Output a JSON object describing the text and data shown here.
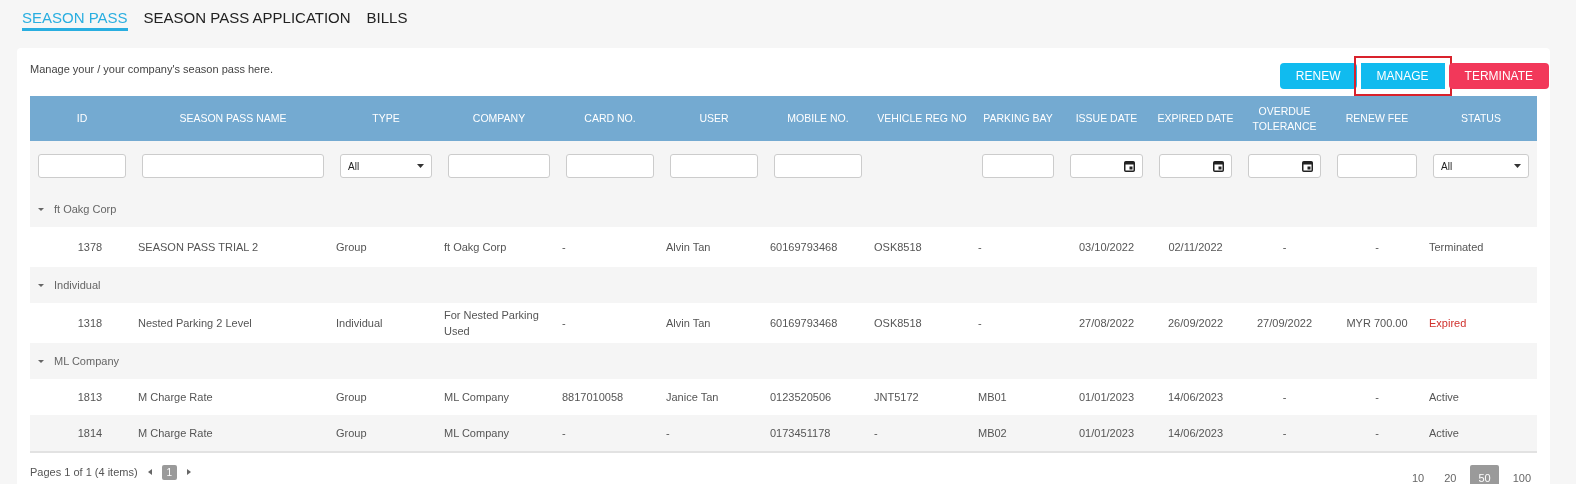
{
  "tabs": [
    {
      "label": "SEASON PASS",
      "selected": true
    },
    {
      "label": "SEASON PASS APPLICATION",
      "selected": false
    },
    {
      "label": "BILLS",
      "selected": false
    }
  ],
  "description": "Manage your / your company's season pass here.",
  "actions": [
    {
      "label": "RENEW",
      "kind": "primary",
      "highlighted": false
    },
    {
      "label": "MANAGE",
      "kind": "primary",
      "highlighted": true
    },
    {
      "label": "TERMINATE",
      "kind": "danger",
      "highlighted": false
    }
  ],
  "table": {
    "columns": [
      {
        "label": "ID",
        "filter": {
          "kind": "text"
        }
      },
      {
        "label": "SEASON PASS NAME",
        "filter": {
          "kind": "text"
        }
      },
      {
        "label": "TYPE",
        "filter": {
          "kind": "select",
          "value": "All"
        }
      },
      {
        "label": "COMPANY",
        "filter": {
          "kind": "text"
        }
      },
      {
        "label": "CARD NO.",
        "filter": {
          "kind": "text"
        }
      },
      {
        "label": "USER",
        "filter": {
          "kind": "text"
        }
      },
      {
        "label": "MOBILE NO.",
        "filter": {
          "kind": "text"
        }
      },
      {
        "label": "VEHICLE REG NO",
        "filter": {
          "kind": "none"
        }
      },
      {
        "label": "PARKING BAY",
        "filter": {
          "kind": "text"
        }
      },
      {
        "label": "ISSUE DATE",
        "filter": {
          "kind": "date"
        }
      },
      {
        "label": "EXPIRED DATE",
        "filter": {
          "kind": "date"
        }
      },
      {
        "label": "OVERDUE TOLERANCE",
        "filter": {
          "kind": "date"
        }
      },
      {
        "label": "RENEW FEE",
        "filter": {
          "kind": "text"
        }
      },
      {
        "label": "STATUS",
        "filter": {
          "kind": "select",
          "value": "All"
        }
      }
    ],
    "groups": [
      {
        "name": "ft Oakg Corp",
        "expanded": true,
        "rows": [
          {
            "cells": [
              "1378",
              "SEASON PASS TRIAL 2",
              "Group",
              "ft Oakg Corp",
              "-",
              "Alvin Tan",
              "60169793468",
              "OSK8518",
              "-",
              "03/10/2022",
              "02/11/2022",
              "-",
              "-",
              "Terminated"
            ],
            "color": "#555555"
          }
        ]
      },
      {
        "name": "Individual",
        "expanded": true,
        "rows": [
          {
            "cells": [
              "1318",
              "Nested Parking 2 Level",
              "Individual",
              "For Nested Parking Used",
              "-",
              "Alvin Tan",
              "60169793468",
              "OSK8518",
              "-",
              "27/08/2022",
              "26/09/2022",
              "27/09/2022",
              "MYR 700.00",
              "Expired"
            ],
            "color": "#d0312d"
          }
        ]
      },
      {
        "name": "ML Company",
        "expanded": true,
        "rows": [
          {
            "cells": [
              "1813",
              "M Charge Rate",
              "Group",
              "ML Company",
              "8817010058",
              "Janice Tan",
              "0123520506",
              "JNT5172",
              "MB01",
              "01/01/2023",
              "14/06/2023",
              "-",
              "-",
              "Active"
            ],
            "color": "#555555"
          },
          {
            "cells": [
              "1814",
              "M Charge Rate",
              "Group",
              "ML Company",
              "-",
              "-",
              "0173451178",
              "-",
              "MB02",
              "01/01/2023",
              "14/06/2023",
              "-",
              "-",
              "Active"
            ],
            "color": "#555555"
          }
        ]
      }
    ]
  },
  "pager": {
    "info": "Pages 1 of 1 (4 items)",
    "pages": [
      {
        "label": "1",
        "selected": true
      }
    ],
    "sizes": [
      {
        "label": "10",
        "selected": false
      },
      {
        "label": "20",
        "selected": false
      },
      {
        "label": "50",
        "selected": true
      },
      {
        "label": "100",
        "selected": false
      }
    ]
  }
}
